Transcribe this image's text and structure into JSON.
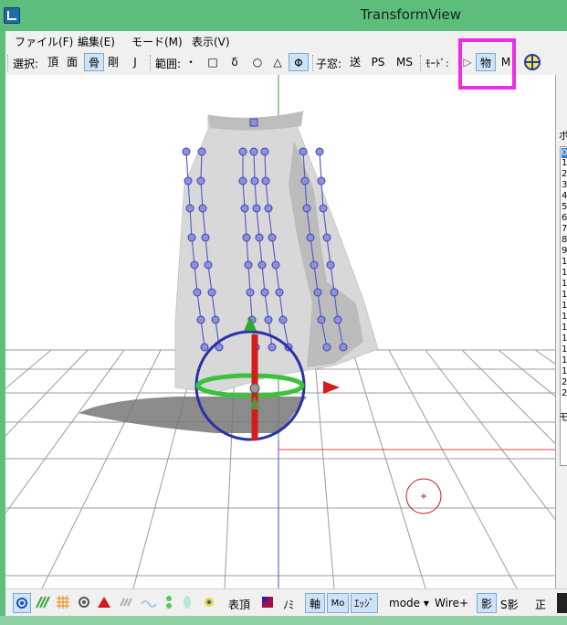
{
  "window": {
    "title": "TransformView"
  },
  "menu": [
    "ファイル(F)",
    "編集(E)",
    "モード(M)",
    "表示(V)"
  ],
  "toolbar": {
    "select_label": "選択:",
    "select_items": [
      "頂",
      "面",
      "骨",
      "剛",
      "J"
    ],
    "range_label": "範囲:",
    "range_items": [
      "・",
      "□",
      "δ",
      "○",
      "△",
      "Φ"
    ],
    "child_label": "子窓:",
    "child_items": [
      "送",
      "PS",
      "MS"
    ],
    "mode_label": "ﾓｰﾄﾞ:",
    "mode_items": [
      "▷",
      "物",
      "M"
    ],
    "transform_icons": [
      "move-xz-icon",
      "move-xy-icon",
      "pen-icon",
      "rotate-icon"
    ]
  },
  "right_panel": {
    "header": "ボ",
    "rows": [
      "0",
      "1",
      "2",
      "3",
      "4",
      "5",
      "6",
      "7",
      "8",
      "9",
      "1",
      "1",
      "1",
      "1",
      "1",
      "1",
      "1",
      "1",
      "1",
      "1",
      "1",
      "2",
      "2"
    ],
    "footer": "モ"
  },
  "bottombar": {
    "vertex_label": "表頂",
    "ruler_label": "ﾉﾐ",
    "axis_label": "軸",
    "morph_label": "Mo",
    "edge_label": "ｴｯｼﾞ",
    "mode_label": "mode ▾",
    "wire_label": "Wire+",
    "shadow_label": "影",
    "sshadow_label": "S影",
    "front_label": "正"
  },
  "colors": {
    "title_bg": "#5dbd7d",
    "bone": "#5a5fc4",
    "gizmo_ring": "#2832a8",
    "axis_y": "#d31c1c",
    "axis_x_ring": "#3bc23b",
    "highlight": "#ee2ce6"
  }
}
